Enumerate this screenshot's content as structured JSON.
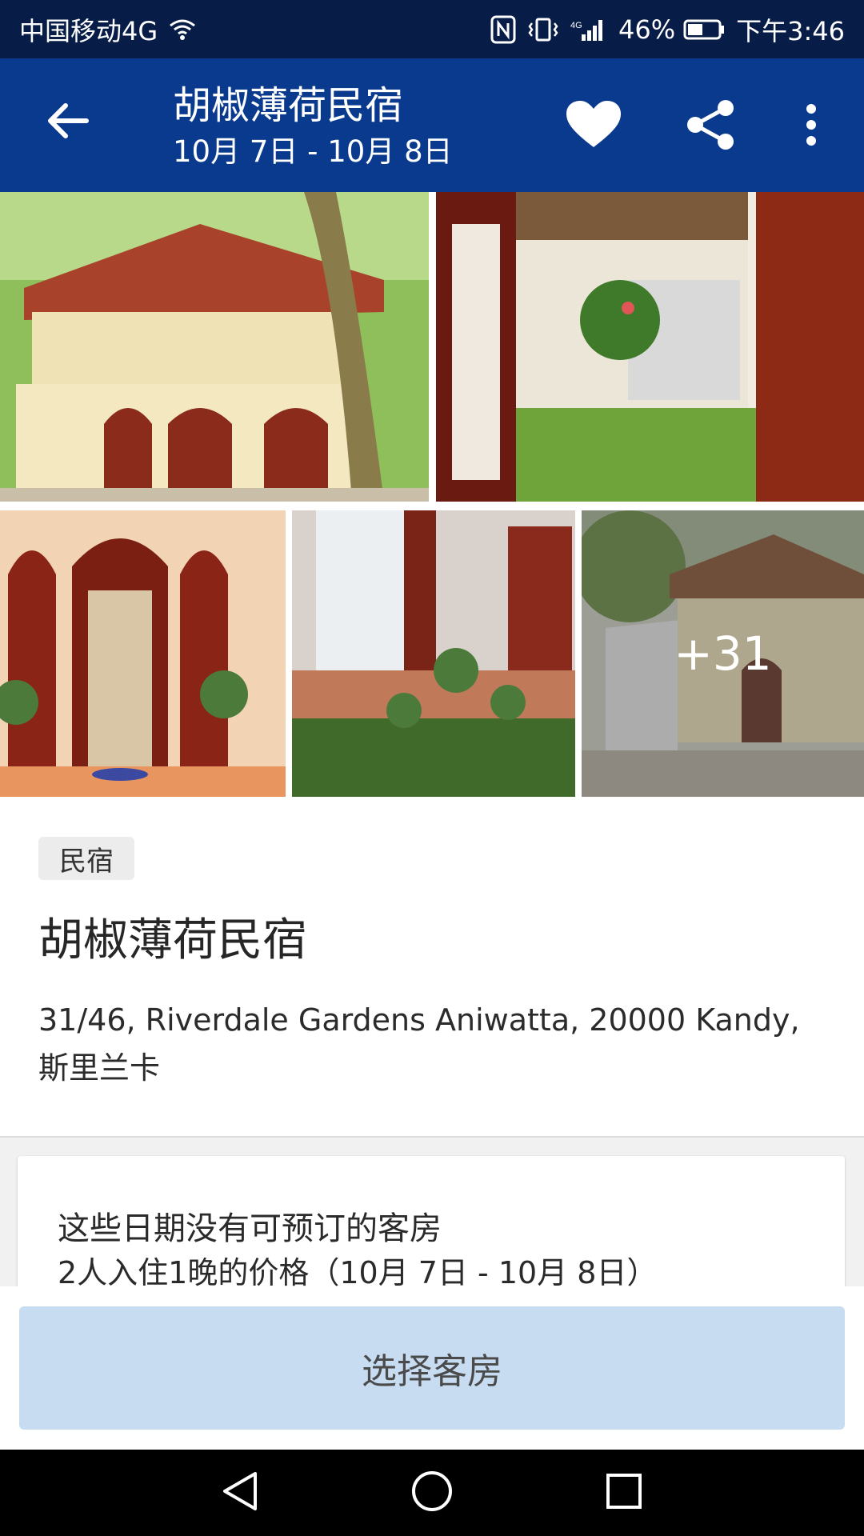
{
  "status_bar": {
    "carrier": "中国移动4G",
    "battery": "46%",
    "time": "下午3:46",
    "icons": [
      "wifi-icon",
      "nfc-icon",
      "vibrate-icon",
      "signal-icon",
      "battery-icon"
    ]
  },
  "app_bar": {
    "title": "胡椒薄荷民宿",
    "dates": "10月 7日 - 10月 8日",
    "icons": [
      "back-arrow-icon",
      "heart-icon",
      "share-icon",
      "more-vert-icon"
    ]
  },
  "gallery": {
    "more_count": "+31"
  },
  "property": {
    "type_tag": "民宿",
    "name": "胡椒薄荷民宿",
    "address": "31/46, Riverdale Gardens Aniwatta, 20000 Kandy, 斯里兰卡"
  },
  "availability": {
    "message": "这些日期没有可预订的客房",
    "price_context": "2人入住1晚的价格（10月 7日 - 10月 8日）"
  },
  "cta": {
    "select_rooms": "选择客房"
  },
  "nav_bar": {
    "icons": [
      "back-triangle-icon",
      "home-circle-icon",
      "recents-square-icon"
    ]
  },
  "colors": {
    "status_bar": "#071c47",
    "app_bar": "#0a3a8e",
    "cta_bg": "#c8dcf1",
    "tag_bg": "#ececec"
  }
}
